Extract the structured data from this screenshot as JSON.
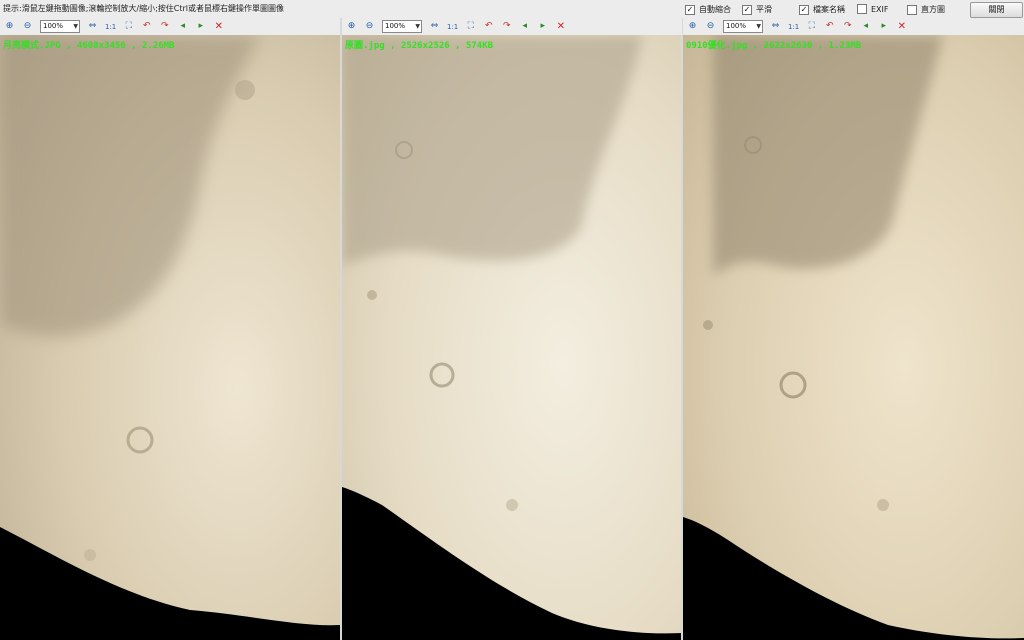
{
  "app": {
    "hint": "提示:滑鼠左鍵拖動圖像;滾輪控制放大/縮小;按住Ctrl或者鼠標右鍵操作單圖圖像",
    "options": [
      {
        "label": "自動縮合",
        "checked": true
      },
      {
        "label": "平滑",
        "checked": true
      },
      {
        "label": "檔案名稱",
        "checked": true
      },
      {
        "label": "EXIF",
        "checked": false
      },
      {
        "label": "直方圖",
        "checked": false
      }
    ],
    "close_label": "關閉"
  },
  "panes": [
    {
      "zoom": "100%",
      "ratio_label": "1:1",
      "caption": "月亮模式.JPG , 4608x3456 , 2.26MB"
    },
    {
      "zoom": "100%",
      "ratio_label": "1:1",
      "caption": "原圖.jpg , 2526x2526 , 574KB"
    },
    {
      "zoom": "100%",
      "ratio_label": "1:1",
      "caption": "0910優化.jpg , 2622x2630 , 1.23MB"
    }
  ],
  "colors": {
    "caption": "#34e024",
    "close_x": "#d62222",
    "toolbar": "#ececec"
  },
  "icons": [
    "zoom-in-icon",
    "zoom-out-icon",
    "fit-icon",
    "actual-size-icon",
    "fullscreen-icon",
    "rotate-left-icon",
    "rotate-right-icon",
    "prev-image-icon",
    "next-image-icon",
    "close-pane-icon"
  ]
}
